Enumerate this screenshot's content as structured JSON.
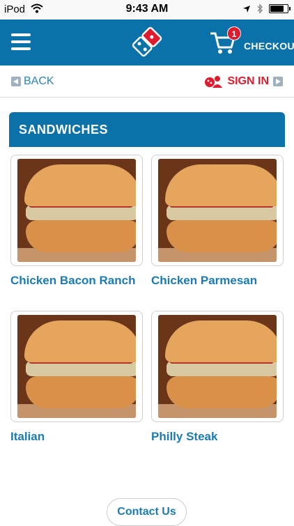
{
  "status": {
    "carrier": "iPod",
    "time": "9:43 AM"
  },
  "header": {
    "cart_count": "1",
    "checkout_label": "CHECKOUT"
  },
  "nav": {
    "back_label": "BACK",
    "signin_label": "SIGN IN"
  },
  "section": {
    "title": "SANDWICHES"
  },
  "items": [
    {
      "name": "Chicken Bacon Ranch"
    },
    {
      "name": "Chicken Parmesan"
    },
    {
      "name": "Italian"
    },
    {
      "name": "Philly Steak"
    }
  ],
  "footer": {
    "contact_label": "Contact Us"
  },
  "colors": {
    "brand_blue": "#0a72a8",
    "accent_red": "#e01b2e",
    "link_blue": "#1a7bb5"
  }
}
